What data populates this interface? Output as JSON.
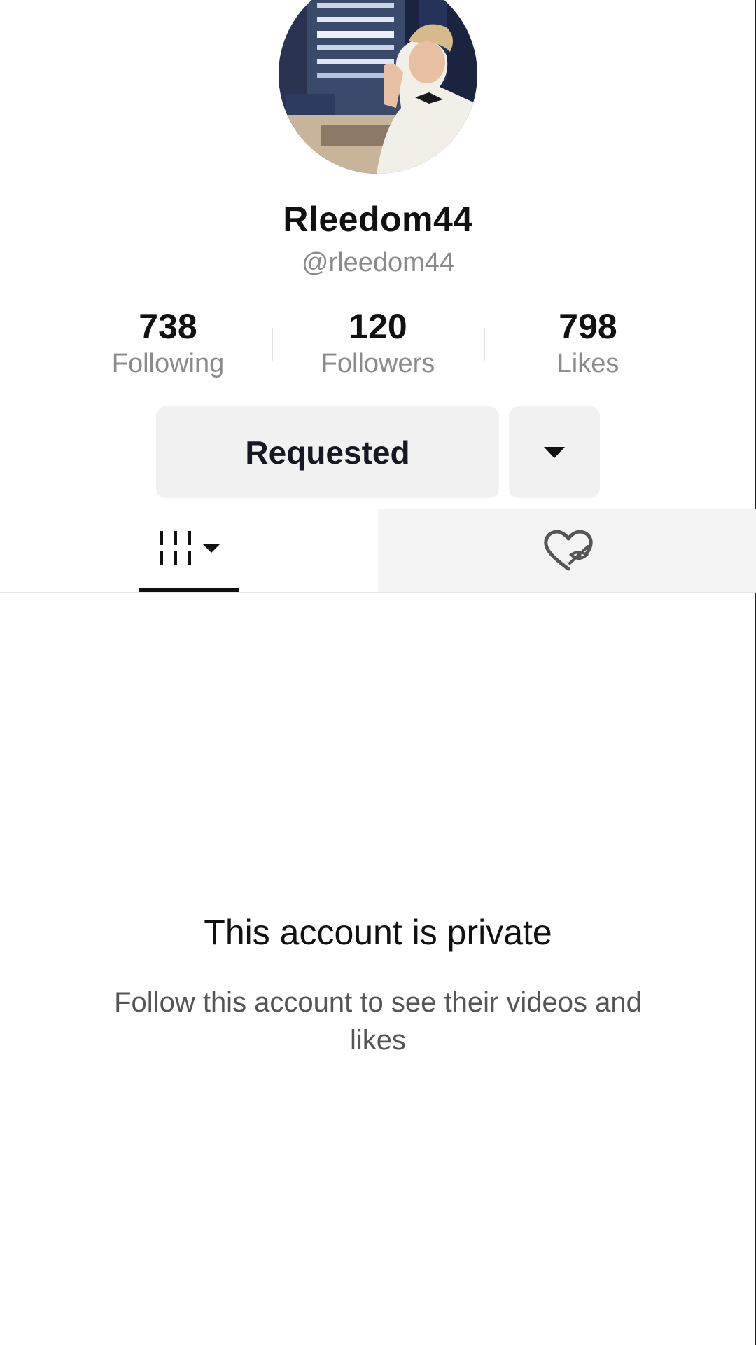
{
  "profile": {
    "display_name": "Rleedom44",
    "username": "@rleedom44",
    "avatar_icon": "profile-photo"
  },
  "stats": {
    "following": {
      "value": "738",
      "label": "Following"
    },
    "followers": {
      "value": "120",
      "label": "Followers"
    },
    "likes": {
      "value": "798",
      "label": "Likes"
    }
  },
  "actions": {
    "follow_status_label": "Requested",
    "more_icon": "caret-down-icon"
  },
  "tabs": [
    {
      "name": "videos",
      "icon": "grid-icon",
      "selected": true
    },
    {
      "name": "liked",
      "icon": "hidden-heart-icon",
      "selected": false
    }
  ],
  "private_notice": {
    "title": "This account is private",
    "message": "Follow this account to see their videos and likes"
  },
  "colors": {
    "button_bg": "#f1f1f2",
    "secondary_text": "#8a8a8a",
    "primary_text": "#111111"
  }
}
